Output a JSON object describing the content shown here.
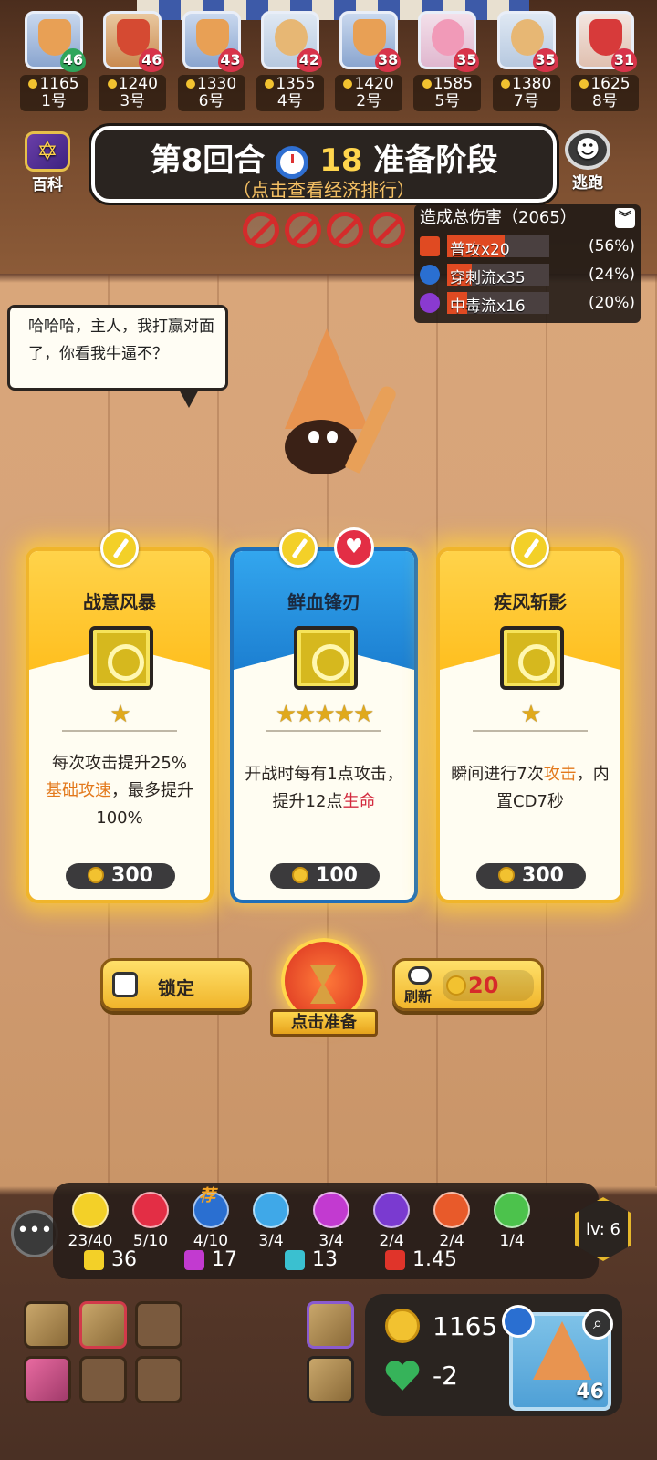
{
  "players": [
    {
      "level": "46",
      "gold": "1165",
      "seat": "1号",
      "level_color": "green"
    },
    {
      "level": "46",
      "gold": "1240",
      "seat": "3号",
      "level_color": "red"
    },
    {
      "level": "43",
      "gold": "1330",
      "seat": "6号",
      "level_color": "red"
    },
    {
      "level": "42",
      "gold": "1355",
      "seat": "4号",
      "level_color": "red"
    },
    {
      "level": "38",
      "gold": "1420",
      "seat": "2号",
      "level_color": "red"
    },
    {
      "level": "35",
      "gold": "1585",
      "seat": "5号",
      "level_color": "red"
    },
    {
      "level": "35",
      "gold": "1380",
      "seat": "7号",
      "level_color": "red"
    },
    {
      "level": "31",
      "gold": "1625",
      "seat": "8号",
      "level_color": "red"
    }
  ],
  "round": {
    "round_label": "第8回合",
    "timer": "18",
    "phase": "准备阶段",
    "subtitle": "（点击查看经济排行）"
  },
  "side": {
    "encyclopedia": "百科",
    "escape": "逃跑"
  },
  "damage": {
    "header": "造成总伤害（2065）",
    "rows": [
      {
        "label": "普攻x20",
        "pct": "(56%)",
        "fill": 56,
        "icon_color": "#e04a22"
      },
      {
        "label": "穿刺流x35",
        "pct": "(24%)",
        "fill": 24,
        "icon_color": "#2a6fd1"
      },
      {
        "label": "中毒流x16",
        "pct": "(20%)",
        "fill": 20,
        "icon_color": "#8a3ad0"
      }
    ]
  },
  "speech": "哈哈哈，主人，我打赢对面了，你看我牛逼不？",
  "cards": [
    {
      "title": "战意风暴",
      "stars": "★",
      "desc_a": "每次攻击提升25%",
      "desc_b": "基础攻速",
      "desc_c": "，最多提升100%",
      "price": "300"
    },
    {
      "title": "鲜血锋刃",
      "stars": "★★★★★",
      "desc_a": "开战时每有1点攻击，提升12点",
      "desc_b": "生命",
      "price": "100"
    },
    {
      "title": "疾风斩影",
      "stars": "★",
      "desc_a": "瞬间进行7次",
      "desc_b": "攻击",
      "desc_c": "，内置CD7秒",
      "price": "300"
    }
  ],
  "buttons": {
    "lock": "锁定",
    "refresh": "刷新",
    "refresh_cost": "20",
    "ready": "点击准备"
  },
  "synergies": [
    {
      "count": "23/40",
      "color": "#f3d028"
    },
    {
      "count": "5/10",
      "color": "#e32e45"
    },
    {
      "count": "4/10",
      "color": "#2a6fd1"
    },
    {
      "count": "3/4",
      "color": "#3fa8e8"
    },
    {
      "count": "3/4",
      "color": "#c23ad0"
    },
    {
      "count": "2/4",
      "color": "#7a3ad0"
    },
    {
      "count": "2/4",
      "color": "#e85a2a"
    },
    {
      "count": "1/4",
      "color": "#4cc24c"
    }
  ],
  "recommend": "荐",
  "stats": {
    "attack": "36",
    "crit": "17",
    "speed": "13",
    "atk_speed": "1.45"
  },
  "level": "lv: 6",
  "wallet": {
    "gold": "1165",
    "hp_change": "-2"
  },
  "portrait_level": "46"
}
